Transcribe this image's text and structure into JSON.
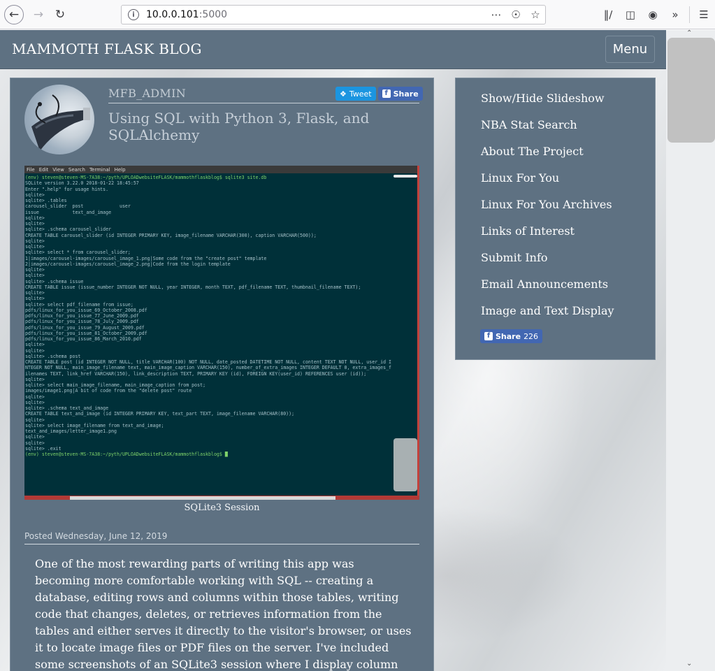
{
  "browser": {
    "url_host": "10.0.0.101",
    "url_port": ":5000"
  },
  "site": {
    "brand": "MAMMOTH FLASK BLOG",
    "menu_label": "Menu"
  },
  "post": {
    "author": "MFB_ADMIN",
    "tweet_label": "Tweet",
    "share_label": "Share",
    "title": "Using SQL with Python 3, Flask, and SQLAlchemy",
    "caption": "SQLite3 Session",
    "posted": "Posted Wednesday, June 12, 2019",
    "body": "One of the most rewarding parts of writing this app was becoming more comfortable working with SQL -- creating a database, editing rows and columns within those tables, writing code that changes, deletes, or retrieves information from the tables and either serves it directly to the visitor's browser, or uses it to locate image files or PDF files on the server. I've included some screenshots of an SQLite3 session where I display column"
  },
  "terminal": {
    "menu": [
      "File",
      "Edit",
      "View",
      "Search",
      "Terminal",
      "Help"
    ],
    "lines": [
      "(env) steven@steven-MS-7A38:~/pyth/UPLOADwebsiteFLASK/mammothflaskblog$ sqlite3 site.db",
      "SQLite version 3.22.0 2018-01-22 18:45:57",
      "Enter \".help\" for usage hints.",
      "sqlite>",
      "sqlite> .tables",
      "carousel_slider  post             user",
      "issue            text_and_image",
      "sqlite>",
      "sqlite>",
      "sqlite> .schema carousel_slider",
      "CREATE TABLE carousel_slider (id INTEGER PRIMARY KEY, image_filename VARCHAR(300), caption VARCHAR(500));",
      "sqlite>",
      "sqlite>",
      "sqlite> select * from carousel_slider;",
      "1|images/carousel-images/carousel_image_1.png|Some code from the \"create post\" template",
      "2|images/carousel-images/carousel_image_2.png|Code from the login template",
      "sqlite>",
      "sqlite>",
      "sqlite> .schema issue",
      "CREATE TABLE issue (issue_number INTEGER NOT NULL, year INTEGER, month TEXT, pdf_filename TEXT, thumbnail_filename TEXT);",
      "sqlite>",
      "sqlite>",
      "sqlite> select pdf_filename from issue;",
      "pdfs/linux_for_you_issue_69_October_2008.pdf",
      "pdfs/linux_for_you_issue_77_June_2009.pdf",
      "pdfs/linux_for_you_issue_78_July_2009.pdf",
      "pdfs/linux_for_you_issue_79_August_2009.pdf",
      "pdfs/linux_for_you_issue_81_October_2009.pdf",
      "pdfs/linux_for_you_issue_86_March_2010.pdf",
      "sqlite>",
      "sqlite>",
      "sqlite> .schema post",
      "CREATE TABLE post (id INTEGER NOT NULL, title VARCHAR(100) NOT NULL, date_posted DATETIME NOT NULL, content TEXT NOT NULL, user_id I",
      "NTEGER NOT NULL, main_image_filename text, main_image_caption VARCHAR(150), number_of_extra_images INTEGER DEFAULT 0, extra_images_f",
      "ilenames TEXT, link_href VARCHAR(150), link_description TEXT, PRIMARY KEY (id), FOREIGN KEY(user_id) REFERENCES user (id));",
      "sqlite>",
      "sqlite> select main_image_filename, main_image_caption from post;",
      "images/image1.png|A bit of code from the \"delete post\" route",
      "sqlite>",
      "sqlite>",
      "sqlite> .schema text_and_image",
      "CREATE TABLE text_and_image (id INTEGER PRIMARY KEY, text_part TEXT, image_filename VARCHAR(80));",
      "sqlite>",
      "sqlite> select image_filename from text_and_image;",
      "text_and_images/letter_image1.png",
      "sqlite>",
      "sqlite>",
      "sqlite> .exit",
      "(env) steven@steven-MS-7A38:~/pyth/UPLOADwebsiteFLASK/mammothflaskblog$ █"
    ]
  },
  "sidebar": {
    "items": [
      "Show/Hide Slideshow",
      "NBA Stat Search",
      "About The Project",
      "Linux For You",
      "Linux For You Archives",
      "Links of Interest",
      "Submit Info",
      "Email Announcements",
      "Image and Text Display"
    ],
    "share_label": "Share",
    "share_count": "226"
  }
}
